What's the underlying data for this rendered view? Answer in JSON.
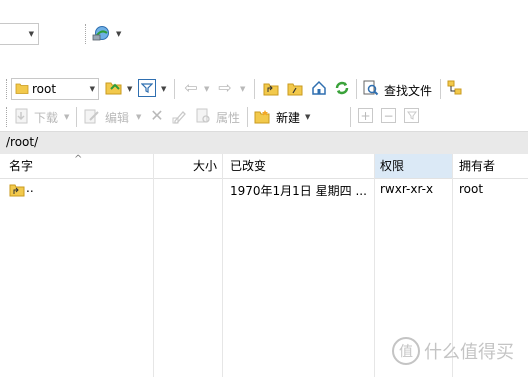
{
  "colors": {
    "path_bar_bg": "#e9e9e9",
    "selected_column_bg": "#dbe9f6",
    "folder_yellow": "#f0c04a",
    "green_refresh": "#3aa23a",
    "watermark": "#c4c4c4"
  },
  "top": {
    "drive_dropdown_value": "",
    "connect_icon": "network-drive-icon"
  },
  "toolbar1": {
    "location_value": "root",
    "find_files_label": "查找文件"
  },
  "toolbar2": {
    "download_label": "下载",
    "edit_label": "编辑",
    "properties_label": "属性",
    "new_label": "新建"
  },
  "path": "/root/",
  "columns": {
    "name": "名字",
    "size": "大小",
    "modified": "已改变",
    "permissions": "权限",
    "owner": "拥有者"
  },
  "rows": [
    {
      "name": "..",
      "size": "",
      "modified": "1970年1月1日 星期四 ...",
      "permissions": "rwxr-xr-x",
      "owner": "root"
    }
  ],
  "watermark": {
    "glyph": "值",
    "text": "什么值得买"
  }
}
